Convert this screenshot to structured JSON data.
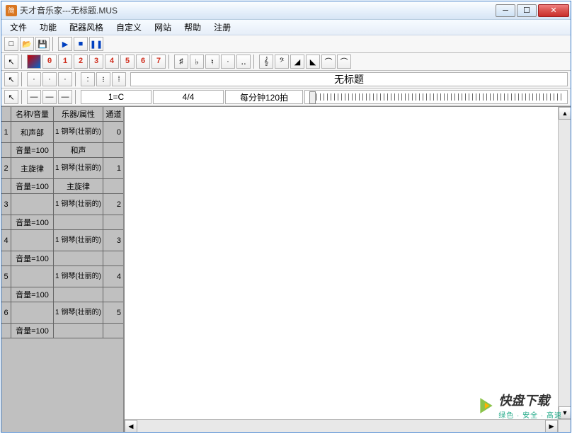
{
  "window": {
    "title": "天才音乐家---无标题.MUS",
    "app_icon_text": "简"
  },
  "menu": {
    "items": [
      "文件",
      "功能",
      "配器风格",
      "自定义",
      "网站",
      "帮助",
      "注册"
    ]
  },
  "toolbar1": {
    "new": "□",
    "open": "📂",
    "save": "💾",
    "play": "▶",
    "stop": "■",
    "pause": "❚❚"
  },
  "toolbar2": {
    "cursor": "↖",
    "eraser": "▰",
    "numbers": [
      "0",
      "1",
      "2",
      "3",
      "4",
      "5",
      "6",
      "7"
    ],
    "music_symbols": [
      "♯",
      "♭",
      "♮",
      "·",
      "‥",
      "𝄞",
      "𝄢",
      "◢",
      "◣",
      "⌒",
      "⌒"
    ]
  },
  "toolbar3": {
    "cursor": "↖",
    "dots1": [
      "·",
      "·",
      "·"
    ],
    "dots2": [
      ":",
      "⁝",
      "⁞"
    ],
    "doc_title": "无标题"
  },
  "toolbar4": {
    "cursor": "↖",
    "lines": [
      "—",
      "—",
      "—"
    ],
    "key": "1=C",
    "time_sig": "4/4",
    "tempo": "每分钟120拍"
  },
  "trackHeader": {
    "col0": "",
    "col1": "名称/音量",
    "col2": "乐器/属性",
    "col3": "通道"
  },
  "tracks": [
    {
      "row": "1",
      "name": "和声部",
      "instr_num": "1",
      "instrument": "钢琴(壮丽的)",
      "channel": "0",
      "volume_label": "音量=100",
      "attr": "和声"
    },
    {
      "row": "2",
      "name": "主旋律",
      "instr_num": "1",
      "instrument": "钢琴(壮丽的)",
      "channel": "1",
      "volume_label": "音量=100",
      "attr": "主旋律"
    },
    {
      "row": "3",
      "name": "",
      "instr_num": "1",
      "instrument": "钢琴(壮丽的)",
      "channel": "2",
      "volume_label": "音量=100",
      "attr": ""
    },
    {
      "row": "4",
      "name": "",
      "instr_num": "1",
      "instrument": "钢琴(壮丽的)",
      "channel": "3",
      "volume_label": "音量=100",
      "attr": ""
    },
    {
      "row": "5",
      "name": "",
      "instr_num": "1",
      "instrument": "钢琴(壮丽的)",
      "channel": "4",
      "volume_label": "音量=100",
      "attr": ""
    },
    {
      "row": "6",
      "name": "",
      "instr_num": "1",
      "instrument": "钢琴(壮丽的)",
      "channel": "5",
      "volume_label": "音量=100",
      "attr": ""
    }
  ],
  "watermark": {
    "brand": "快盘下载",
    "tagline": "绿色 · 安全 · 高速"
  }
}
